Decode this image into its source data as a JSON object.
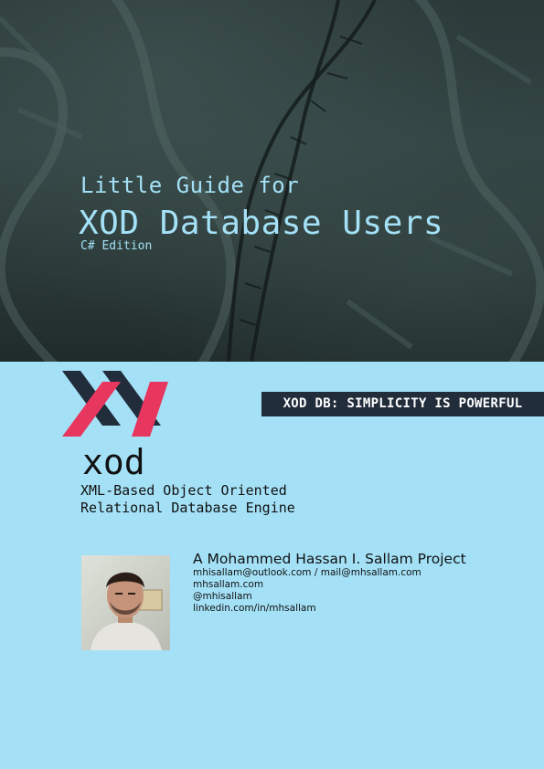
{
  "cover": {
    "title_line1": "Little Guide for",
    "title_line2": "XOD Database Users",
    "edition": "C# Edition"
  },
  "banner": {
    "text": "XOD DB: SIMPLICITY IS POWERFUL"
  },
  "brand": {
    "name": "xod",
    "tagline_line1": "XML-Based Object Oriented",
    "tagline_line2": "Relational Database Engine"
  },
  "author": {
    "project": "A Mohammed Hassan I. Sallam Project",
    "email": "mhisallam@outlook.com / mail@mhsallam.com",
    "website": "mhsallam.com",
    "handle": "@mhisallam",
    "linkedin": "linkedin.com/in/mhsallam"
  },
  "colors": {
    "cover_top": "#2b3a39",
    "accent_text": "#a4e1f7",
    "page_bg": "#a4e1f7",
    "banner_bg": "#222d3c",
    "logo_dark": "#222d3c",
    "logo_red": "#e8375f"
  }
}
